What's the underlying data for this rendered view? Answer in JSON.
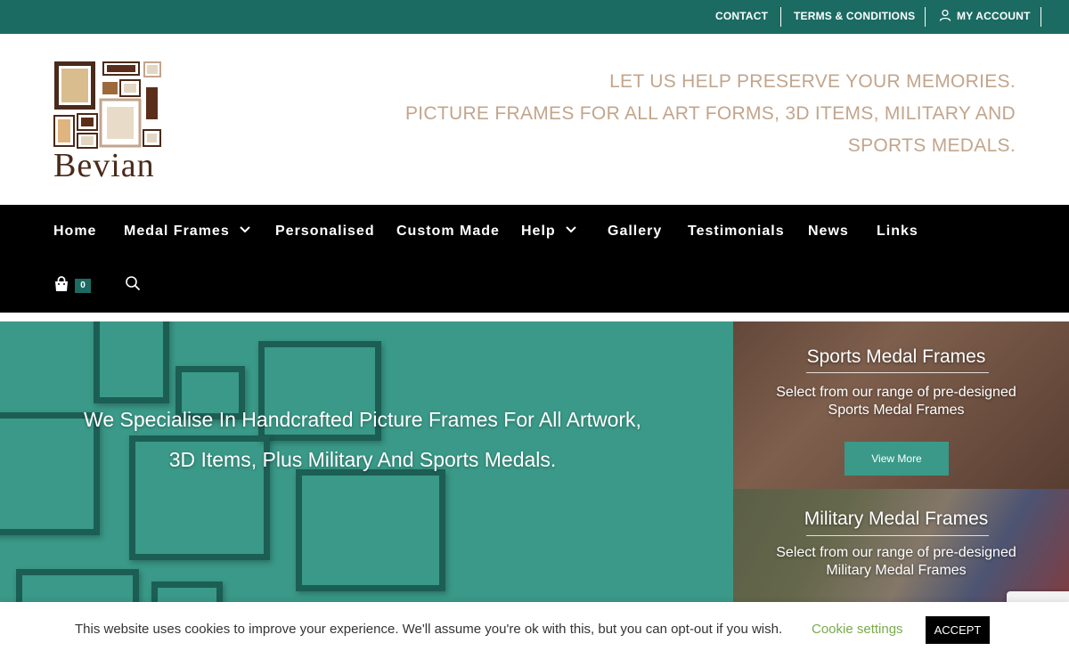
{
  "topbar": {
    "contact": "CONTACT",
    "terms": "TERMS & CONDITIONS",
    "account": "MY ACCOUNT",
    "icons": {
      "account": "user-icon"
    }
  },
  "header": {
    "logo_text": "Bevian",
    "tagline_line1": "LET US HELP PRESERVE YOUR MEMORIES.",
    "tagline_line2": "PICTURE FRAMES FOR ALL ART FORMS, 3D ITEMS, MILITARY AND SPORTS MEDALS."
  },
  "nav": {
    "items": [
      "Home",
      "Medal Frames",
      "Personalised",
      "Custom Made",
      "Help",
      "Gallery",
      "Testimonials",
      "News",
      "Links"
    ],
    "cart_count": "0",
    "icons": {
      "dropdown": "chevron-down-icon",
      "cart": "shopping-bag-icon",
      "search": "search-icon"
    }
  },
  "hero": {
    "line1": "We Specialise In Handcrafted Picture Frames For All Artwork,",
    "line2": "3D Items, Plus Military And Sports Medals."
  },
  "panels": {
    "sports": {
      "title": "Sports Medal Frames",
      "desc_line1": "Select from our range of pre-designed",
      "desc_line2": "Sports Medal Frames",
      "button": "View More"
    },
    "military": {
      "title": "Military Medal Frames",
      "desc_line1": "Select from our range of pre-designed",
      "desc_line2": "Military Medal Frames"
    }
  },
  "cookie": {
    "text": "This website uses cookies to improve your experience. We'll assume you're ok with this, but you can opt-out if you wish.",
    "settings": "Cookie settings",
    "accept": "ACCEPT"
  },
  "colors": {
    "topbar": "#1b6b62",
    "accent": "#3a9988",
    "tagline": "#c2a58c",
    "nav_bg": "#000000",
    "cookie_link": "#7aab4a"
  }
}
